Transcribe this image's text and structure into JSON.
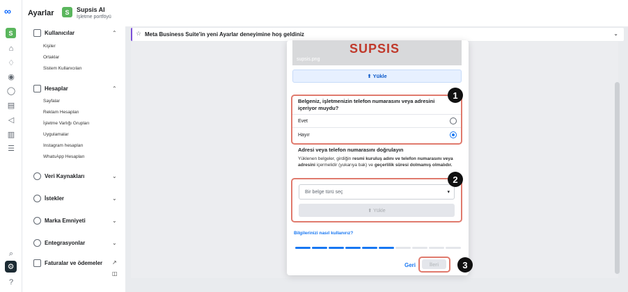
{
  "header": {
    "title": "Ayarlar",
    "business_avatar": "S",
    "business_name": "Supsis AI",
    "business_subtitle": "İşletme portföyü"
  },
  "rail": {
    "avatar": "S",
    "icons": [
      "meta-logo-icon",
      "home-icon",
      "bell-icon",
      "compass-icon",
      "chat-icon",
      "posts-icon",
      "megaphone-icon",
      "chart-icon",
      "menu-icon",
      "search-icon",
      "gear-icon",
      "help-icon"
    ]
  },
  "sidebar": {
    "users": {
      "label": "Kullanıcılar",
      "items": [
        "Kişiler",
        "Ortaklar",
        "Sistem Kullanıcıları"
      ]
    },
    "accounts": {
      "label": "Hesaplar",
      "items": [
        "Sayfalar",
        "Reklam Hesapları",
        "İşletme Varlığı Grupları",
        "Uygulamalar",
        "Instagram hesapları",
        "WhatsApp Hesapları"
      ]
    },
    "data_sources": {
      "label": "Veri Kaynakları"
    },
    "requests": {
      "label": "İstekler"
    },
    "brand_safety": {
      "label": "Marka Emniyeti"
    },
    "integrations": {
      "label": "Entegrasyonlar"
    },
    "billing": {
      "label": "Faturalar ve ödemeler"
    }
  },
  "banner": {
    "text": "Meta Business Suite'in yeni Ayarlar deneyimine hoş geldiniz"
  },
  "modal": {
    "preview_logo": "SUPSIS",
    "preview_filename": "supsis.png",
    "upload_label": "⬆ Yükle",
    "question": "Belgeniz, işletmenizin telefon numarasını veya adresini içeriyor muydu?",
    "option_yes": "Evet",
    "option_no": "Hayır",
    "selected": "Hayır",
    "verify_title": "Adresi veya telefon numarasını doğrulayın",
    "verify_desc_1": "Yüklenen belgeler, girdiğin ",
    "verify_desc_b1": "resmi kuruluş adını ve telefon numarasını veya adresini",
    "verify_desc_2": " içermelidir (yukarıya bak) ve ",
    "verify_desc_b2": "geçerlilik süresi dolmamış olmalıdır.",
    "doc_type_placeholder": "Bir belge türü seç",
    "upload_disabled_label": "⬆ Yükle",
    "help_link": "Bilgilerinizi nasıl kullanırız?",
    "progress_total": 10,
    "progress_done": 6,
    "back_label": "Geri",
    "next_label": "İleri"
  },
  "annotations": [
    "1",
    "2",
    "3"
  ],
  "colors": {
    "accent": "#1877f2",
    "highlight": "#e07a6d",
    "brand": "#5ab65d"
  }
}
